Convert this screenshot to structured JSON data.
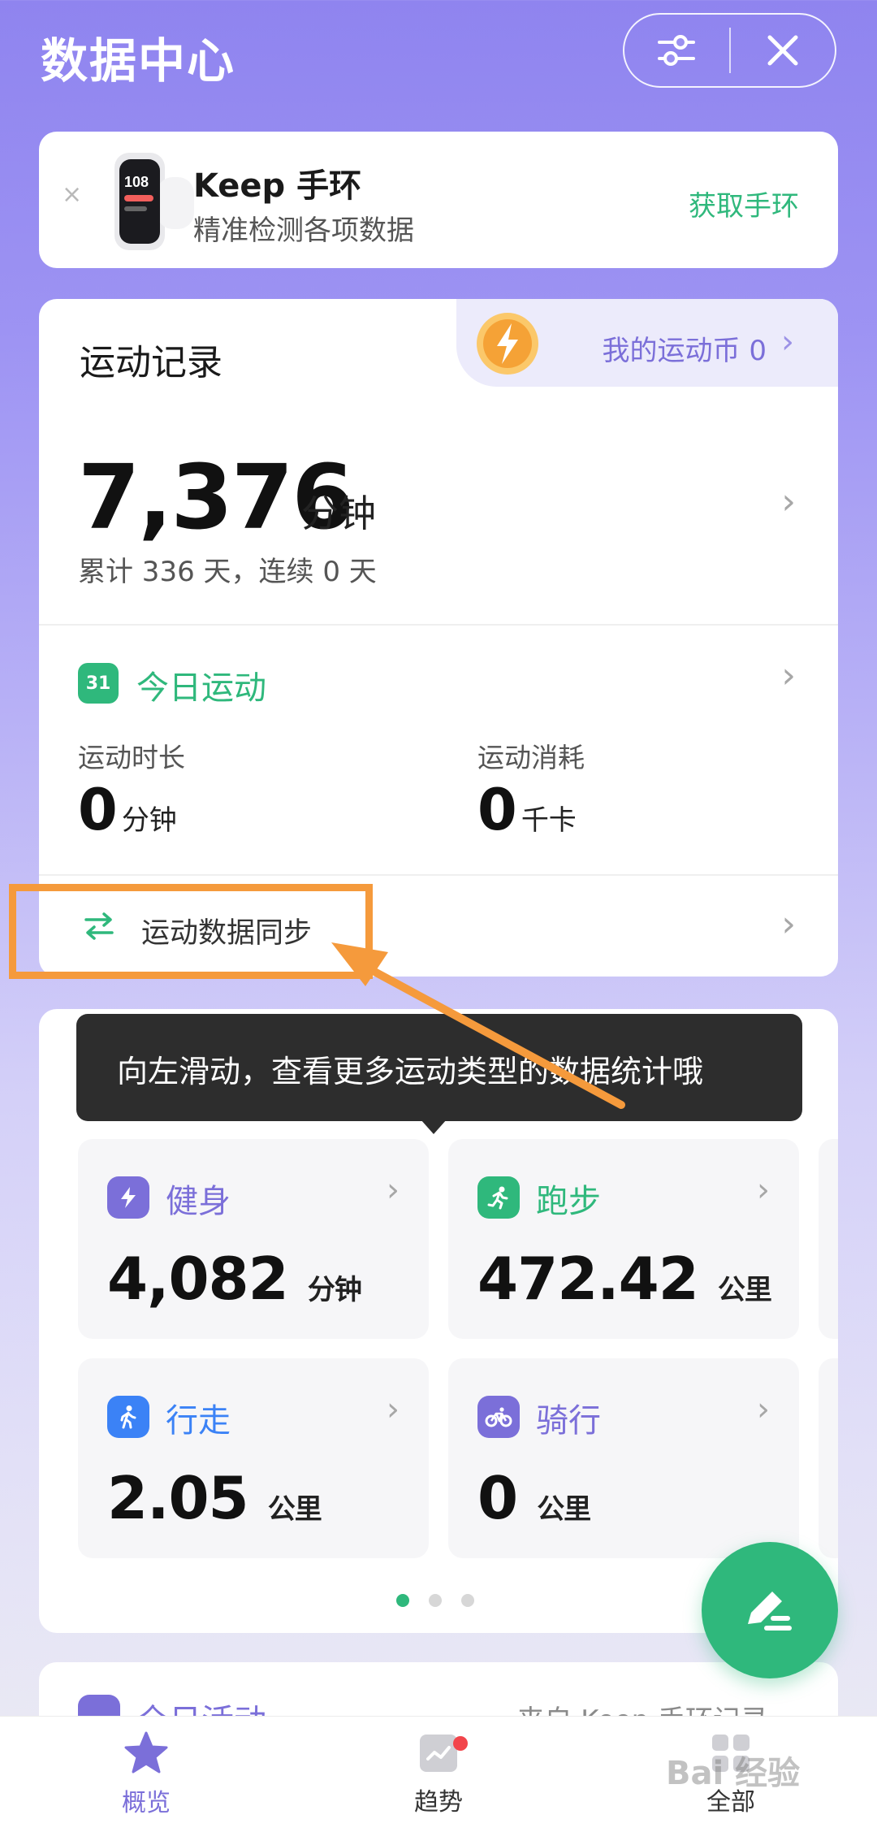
{
  "header": {
    "title": "数据中心",
    "settings_icon": "sliders-icon",
    "close_icon": "close-icon"
  },
  "banner": {
    "close_glyph": "×",
    "title": "Keep 手环",
    "subtitle": "精准检测各项数据",
    "cta": "获取手环",
    "device_time": "108"
  },
  "records": {
    "title": "运动记录",
    "coins_text": "我的运动币 0",
    "total_value": "7,376",
    "total_unit": "分钟",
    "cumulative": "累计 336 天，连续 0 天",
    "today": {
      "title": "今日运动",
      "icon_text": "31",
      "duration_label": "运动时长",
      "duration_value": "0",
      "duration_unit": "分钟",
      "calories_label": "运动消耗",
      "calories_value": "0",
      "calories_unit": "千卡"
    },
    "sync_label": "运动数据同步"
  },
  "types": {
    "tooltip": "向左滑动，查看更多运动类型的数据统计哦",
    "tiles": [
      {
        "label": "健身",
        "value": "4,082",
        "unit": "分钟",
        "color": "#7b6fd9",
        "icon": "lightning-icon"
      },
      {
        "label": "跑步",
        "value": "472.42",
        "unit": "公里",
        "color": "#2fb87c",
        "icon": "runner-icon"
      },
      {
        "label": "行走",
        "value": "2.05",
        "unit": "公里",
        "color": "#3b82f6",
        "icon": "walker-icon"
      },
      {
        "label": "骑行",
        "value": "0",
        "unit": "公里",
        "color": "#7b6fd9",
        "icon": "bicycle-icon"
      }
    ],
    "page_index": 1,
    "page_count": 3
  },
  "activity": {
    "title": "全日活动",
    "source": "来自 Keep 手环记录"
  },
  "nav": {
    "items": [
      {
        "label": "概览"
      },
      {
        "label": "趋势"
      },
      {
        "label": "全部"
      }
    ]
  },
  "watermark": "Bai 经验",
  "colors": {
    "accent_green": "#2fb87c",
    "accent_purple": "#7b6fd9",
    "highlight": "#f59a3c"
  }
}
